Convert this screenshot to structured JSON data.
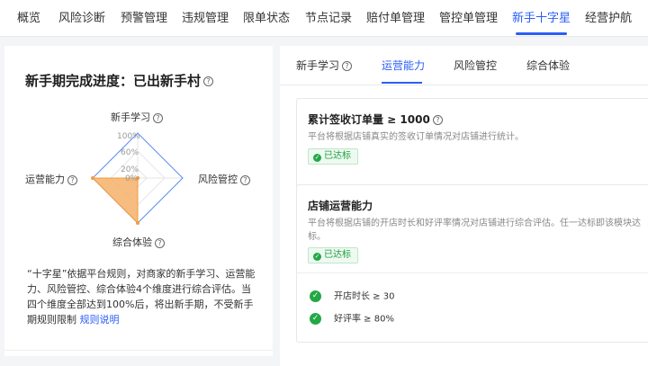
{
  "topnav": {
    "tabs": [
      {
        "label": "概览",
        "active": false
      },
      {
        "label": "风险诊断",
        "active": false
      },
      {
        "label": "预警管理",
        "active": false
      },
      {
        "label": "违规管理",
        "active": false
      },
      {
        "label": "限单状态",
        "active": false
      },
      {
        "label": "节点记录",
        "active": false
      },
      {
        "label": "赔付单管理",
        "active": false
      },
      {
        "label": "管控单管理",
        "active": false
      },
      {
        "label": "新手十字星",
        "active": true
      },
      {
        "label": "经营护航",
        "active": false
      }
    ]
  },
  "left": {
    "title": "新手期完成进度：已出新手村",
    "help_icon": "?",
    "radar": {
      "axes": [
        "新手学习",
        "风险管控",
        "综合体验",
        "运营能力"
      ],
      "ticks": [
        "100%",
        "60%",
        "20%",
        "0%"
      ],
      "values": {
        "新手学习": 0,
        "风险管控": 0,
        "综合体验": 100,
        "运营能力": 100
      },
      "fill_color": "#f5b06a",
      "outline_color": "#5b8ff9"
    },
    "desc_text": "“十字星”依据平台规则，对商家的新手学习、运营能力、风险管控、综合体验4个维度进行综合评估。当四个维度全部达到100%后，将出新手期，不受新手期规则限制",
    "desc_link": "规则说明"
  },
  "right": {
    "subtabs": [
      {
        "label": "新手学习",
        "has_help": true,
        "active": false
      },
      {
        "label": "运营能力",
        "has_help": false,
        "active": true
      },
      {
        "label": "风险管控",
        "has_help": false,
        "active": false
      },
      {
        "label": "综合体验",
        "has_help": false,
        "active": false
      }
    ],
    "cards": [
      {
        "title": "累计签收订单量 ≥ 1000",
        "desc": "平台将根据店铺真实的签收订单情况对店铺进行统计。",
        "badge": "已达标"
      },
      {
        "title": "店铺运营能力",
        "desc": "平台将根据店铺的开店时长和好评率情况对店铺进行综合评估。任一达标即该模块达标。",
        "badge": "已达标",
        "criteria": [
          "开店时长 ≥ 30",
          "好评率 ≥ 80%"
        ]
      }
    ]
  },
  "colors": {
    "accent": "#2b5ef5",
    "success": "#23a845"
  }
}
